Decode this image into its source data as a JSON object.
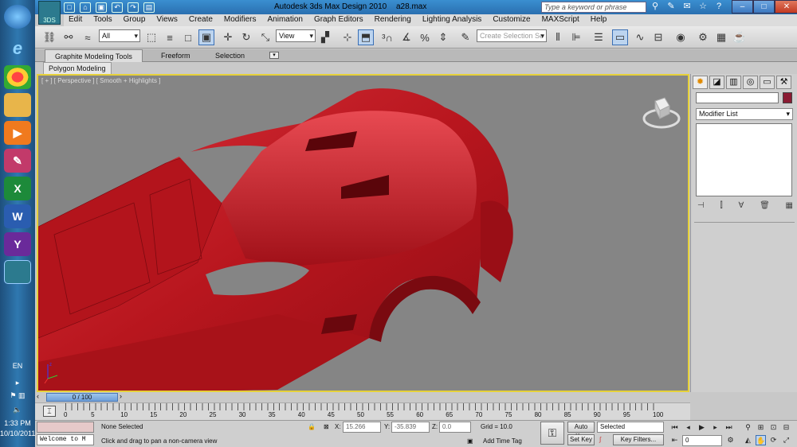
{
  "window": {
    "title": "Autodesk 3ds Max Design 2010",
    "file": "a28.max",
    "app_badge": "3DS",
    "search_placeholder": "Type a keyword or phrase"
  },
  "menus": [
    "Edit",
    "Tools",
    "Group",
    "Views",
    "Create",
    "Modifiers",
    "Animation",
    "Graph Editors",
    "Rendering",
    "Lighting Analysis",
    "Customize",
    "MAXScript",
    "Help"
  ],
  "toolbar": {
    "selection_filter": "All",
    "reference_coord": "View",
    "named_selection_placeholder": "Create Selection Se"
  },
  "ribbon": {
    "tabs": [
      "Graphite Modeling Tools",
      "Freeform",
      "Selection"
    ],
    "panel": "Polygon Modeling"
  },
  "viewport": {
    "label": "[ + ] [ Perspective ] [ Smooth + Highlights ]",
    "model_color": "#c41e26"
  },
  "command_panel": {
    "modifier_list": "Modifier List",
    "object_color": "#8a1a32"
  },
  "timeline": {
    "slider": "0 / 100",
    "ticks": [
      "0",
      "5",
      "10",
      "15",
      "20",
      "25",
      "30",
      "35",
      "40",
      "45",
      "50",
      "55",
      "60",
      "65",
      "70",
      "75",
      "80",
      "85",
      "90",
      "95",
      "100"
    ]
  },
  "status": {
    "maxscript_listener": "Welcome to M",
    "selection": "None Selected",
    "prompt": "Click and drag to pan a non-camera view",
    "x_label": "X:",
    "x_value": "15.266",
    "y_label": "Y:",
    "y_value": "-35.839",
    "z_label": "Z:",
    "z_value": "0.0",
    "grid": "Grid = 10.0",
    "add_time_tag": "Add Time Tag",
    "auto_key": "Auto Key",
    "set_key": "Set Key",
    "key_mode": "Selected",
    "key_filters": "Key Filters...",
    "frame": "0"
  },
  "tray": {
    "lang": "EN",
    "time": "1:33 PM",
    "date": "10/10/2011"
  }
}
